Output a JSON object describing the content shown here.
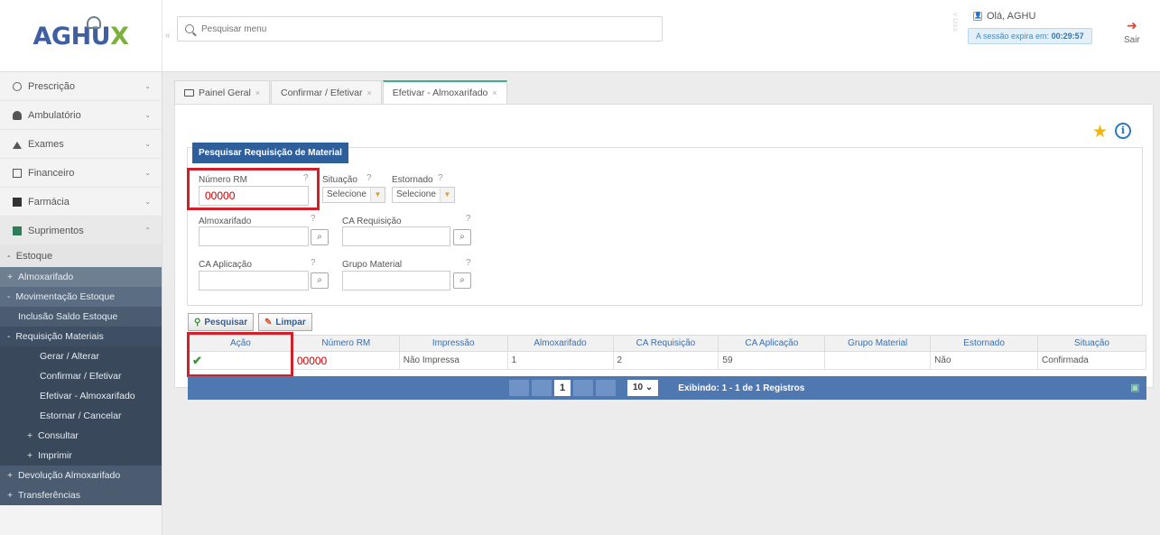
{
  "app": {
    "logo_main": "AGHU",
    "logo_x": "X"
  },
  "header": {
    "search_placeholder": "Pesquisar menu",
    "version": "V 123.0",
    "greeting": "Olá, AGHU",
    "session_prefix": "A sessão expira em:",
    "session_time": "00:29:57",
    "logout_label": "Sair"
  },
  "sidebar": {
    "items": [
      {
        "label": "Prescrição"
      },
      {
        "label": "Ambulatório"
      },
      {
        "label": "Exames"
      },
      {
        "label": "Financeiro"
      },
      {
        "label": "Farmácia"
      },
      {
        "label": "Suprimentos"
      }
    ],
    "estoque": "Estoque",
    "sub": [
      "Almoxarifado",
      "Movimentação Estoque",
      "Inclusão Saldo Estoque",
      "Requisição Materiais",
      "Gerar / Alterar",
      "Confirmar / Efetivar",
      "Efetivar - Almoxarifado",
      "Estornar / Cancelar",
      "Consultar",
      "Imprimir",
      "Devolução Almoxarifado",
      "Transferências"
    ]
  },
  "tabs": [
    {
      "label": "Painel Geral"
    },
    {
      "label": "Confirmar / Efetivar"
    },
    {
      "label": "Efetivar - Almoxarifado"
    }
  ],
  "form": {
    "legend": "Pesquisar Requisição de Material",
    "numero_rm_label": "Número RM",
    "numero_rm_value": "00000",
    "situacao_label": "Situação",
    "situacao_value": "Selecione",
    "estornado_label": "Estornado",
    "estornado_value": "Selecione",
    "almoxarifado_label": "Almoxarifado",
    "ca_requisicao_label": "CA Requisição",
    "ca_aplicacao_label": "CA Aplicação",
    "grupo_material_label": "Grupo Material",
    "pesquisar": "Pesquisar",
    "limpar": "Limpar"
  },
  "grid": {
    "columns": [
      "Ação",
      "Número RM",
      "Impressão",
      "Almoxarifado",
      "CA Requisição",
      "CA Aplicação",
      "Grupo Material",
      "Estornado",
      "Situação"
    ],
    "rows": [
      {
        "numero_rm": "00000",
        "impressao": "Não Impressa",
        "almoxarifado": "1",
        "ca_requisicao": "2",
        "ca_aplicacao": "59",
        "grupo_material": "",
        "estornado": "Não",
        "situacao": "Confirmada"
      }
    ]
  },
  "pager": {
    "current_page": "1",
    "page_size": "10",
    "info": "Exibindo: 1 - 1 de 1 Registros"
  },
  "colors": {
    "accent": "#2f5f9a",
    "highlight_box": "#d0202a",
    "pager_bg": "#4f77b0"
  }
}
